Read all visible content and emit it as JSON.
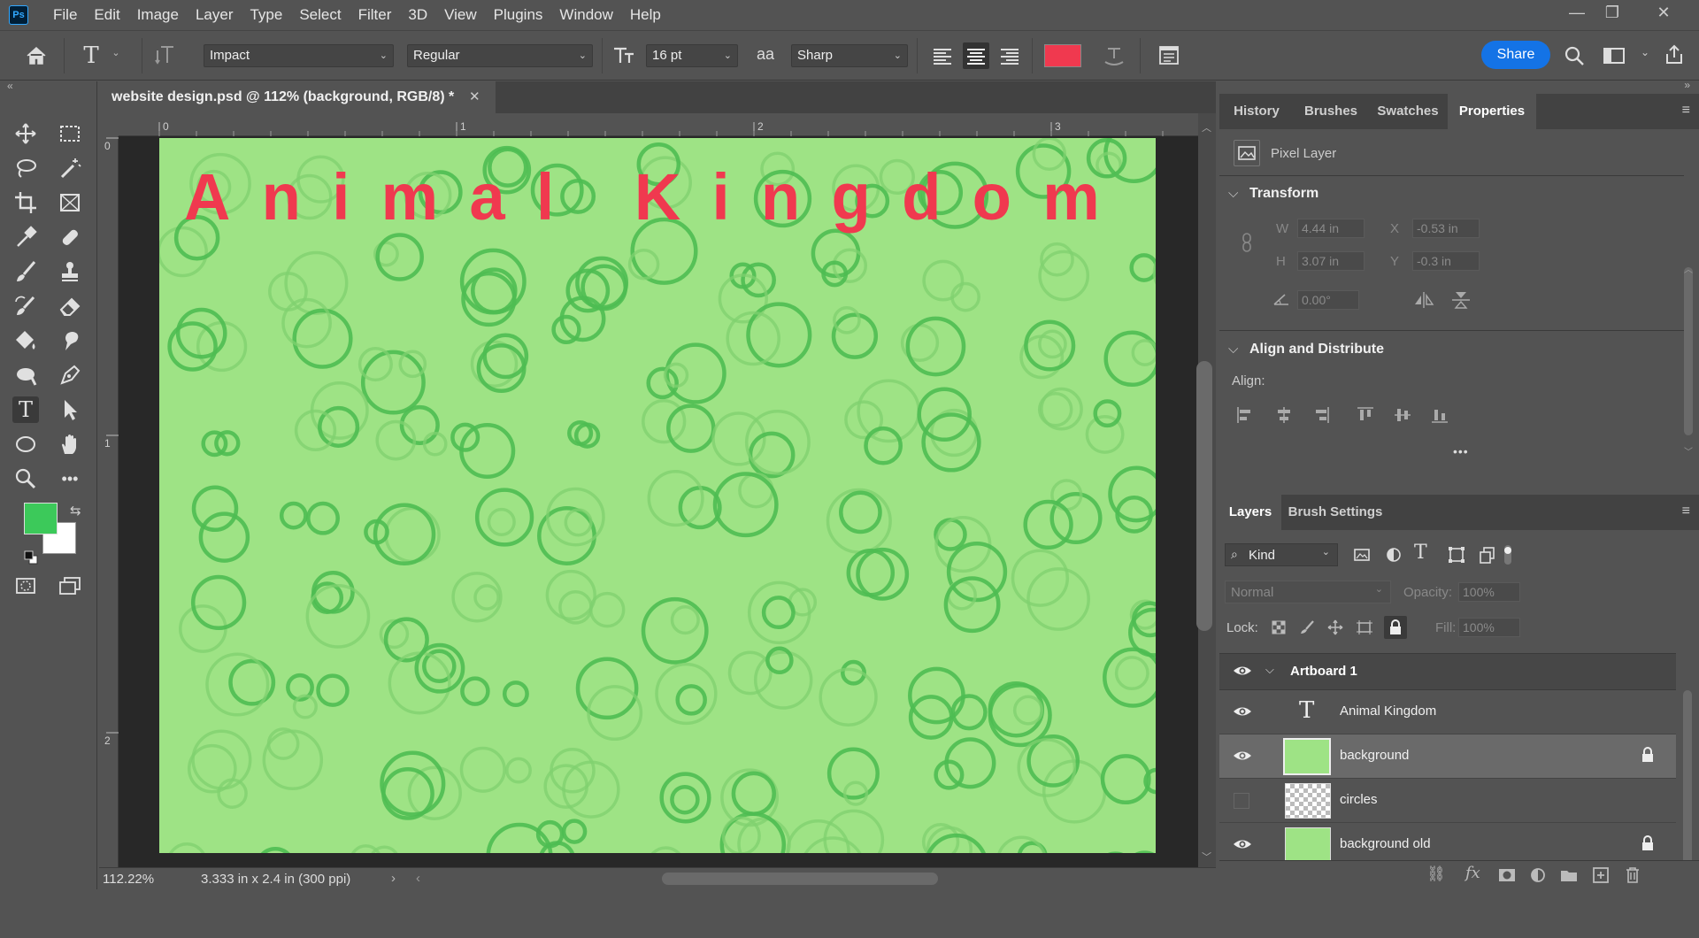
{
  "app": {
    "logo": "Ps"
  },
  "menu": [
    "File",
    "Edit",
    "Image",
    "Layer",
    "Type",
    "Select",
    "Filter",
    "3D",
    "View",
    "Plugins",
    "Window",
    "Help"
  ],
  "window_controls": {
    "minimize": "—",
    "restore": "❐",
    "close": "✕"
  },
  "options": {
    "font_family": "Impact",
    "font_style": "Regular",
    "font_size": "16 pt",
    "aa_icon_label": "aa",
    "antialias": "Sharp",
    "text_color": "#f0394f",
    "share_label": "Share"
  },
  "document": {
    "tab_title": "website design.psd @ 112% (background, RGB/8) *",
    "artboard_text": "Animal Kingdom",
    "artboard_bg": "#9ee385",
    "ruler_h": [
      "0",
      "1",
      "2",
      "3"
    ],
    "ruler_v": [
      "0",
      "1",
      "2"
    ],
    "zoom": "112.22%",
    "doc_size": "3.333 in x 2.4 in (300 ppi)"
  },
  "colors": {
    "foreground": "#3cc95a",
    "background": "#ffffff",
    "accent": "#1473e6"
  },
  "panels": {
    "top_tabs": [
      "History",
      "Brushes",
      "Swatches",
      "Properties"
    ],
    "active_top_tab": "Properties",
    "properties": {
      "layer_type": "Pixel Layer",
      "transform_title": "Transform",
      "w_label": "W",
      "w_value": "4.44 in",
      "h_label": "H",
      "h_value": "3.07 in",
      "x_label": "X",
      "x_value": "-0.53 in",
      "y_label": "Y",
      "y_value": "-0.3 in",
      "angle_value": "0.00°",
      "align_title": "Align and Distribute",
      "align_label": "Align:",
      "more": "•••"
    },
    "layer_tabs": [
      "Layers",
      "Brush Settings"
    ],
    "layers": {
      "filter_kind": "Kind",
      "blend_mode": "Normal",
      "opacity_label": "Opacity:",
      "opacity_value": "100%",
      "lock_label": "Lock:",
      "fill_label": "Fill:",
      "fill_value": "100%",
      "group_name": "Artboard 1",
      "items": [
        {
          "name": "Animal Kingdom",
          "type": "text",
          "visible": true
        },
        {
          "name": "background",
          "type": "pixel",
          "visible": true,
          "locked": true,
          "selected": true
        },
        {
          "name": "circles",
          "type": "pixel",
          "visible": false
        },
        {
          "name": "background old",
          "type": "pixel",
          "visible": true,
          "locked": true
        }
      ]
    }
  }
}
